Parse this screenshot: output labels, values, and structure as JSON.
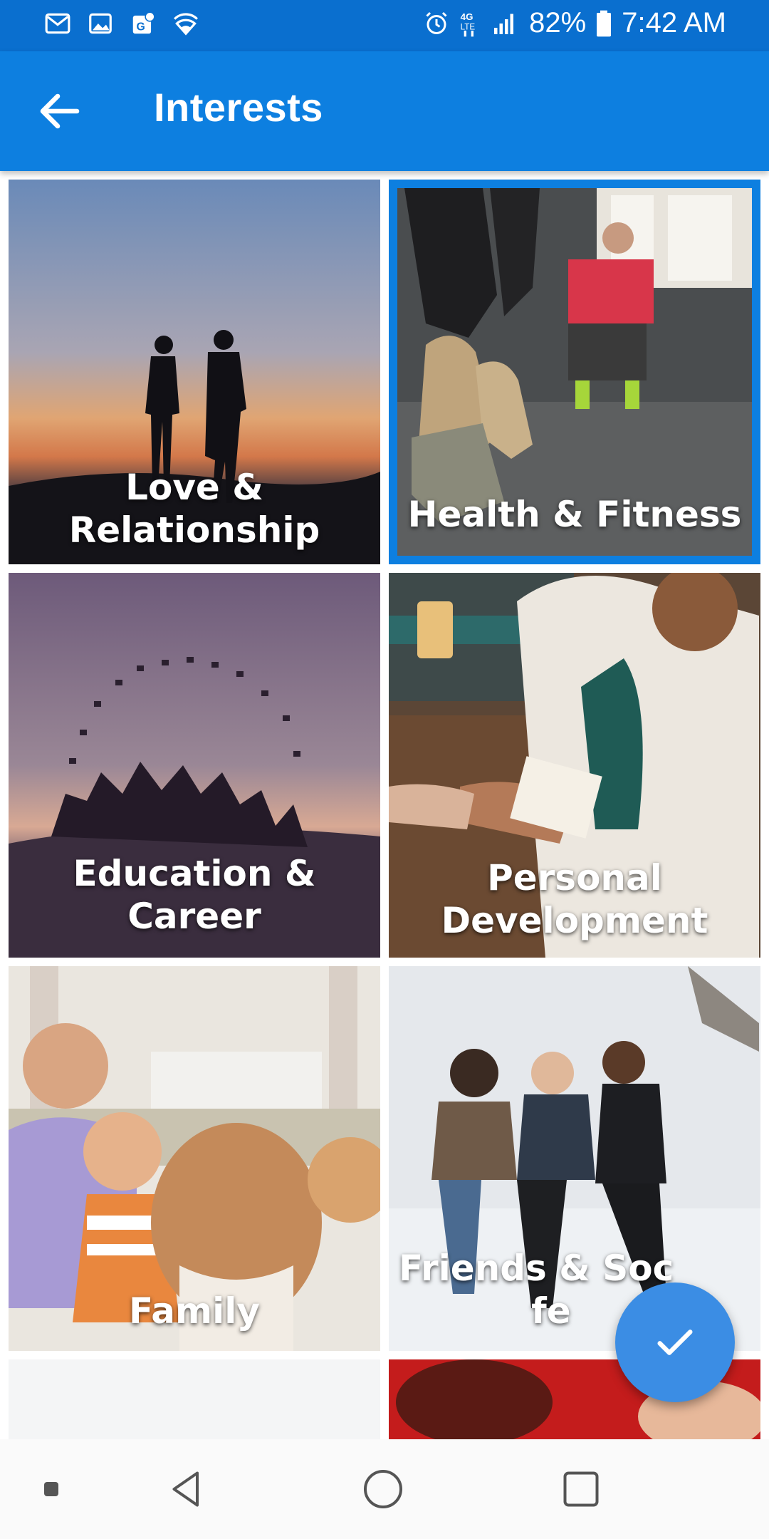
{
  "status_bar": {
    "battery_percent": "82%",
    "network": "4G LTE",
    "time": "7:42 AM",
    "icons": [
      "gmail-icon",
      "gallery-icon",
      "maps-icon",
      "wifi-shield-icon",
      "alarm-icon",
      "data-icon",
      "signal-icon",
      "battery-icon"
    ]
  },
  "app_bar": {
    "title": "Interests",
    "back_icon": "arrow-back-icon"
  },
  "interests": [
    {
      "label": "Love & Relationship",
      "selected": false
    },
    {
      "label": "Health & Fitness",
      "selected": true
    },
    {
      "label": "Education & Career",
      "selected": false
    },
    {
      "label_line1": "Personal",
      "label_line2": "Development",
      "selected": false
    },
    {
      "label": "Family",
      "selected": false
    },
    {
      "label": "Friends & Social Life",
      "visible_text": "Friends & Soc",
      "visible_tail": "fe",
      "selected": false
    }
  ],
  "fab": {
    "icon": "check-icon",
    "color": "#3b8de4"
  },
  "nav_bar": {
    "icons": [
      "recents-dot-icon",
      "back-triangle-icon",
      "home-circle-icon",
      "overview-square-icon"
    ]
  },
  "colors": {
    "primary": "#0d7fe0",
    "status_bar": "#0a6fcf",
    "selection_border": "#0d7fe0"
  }
}
